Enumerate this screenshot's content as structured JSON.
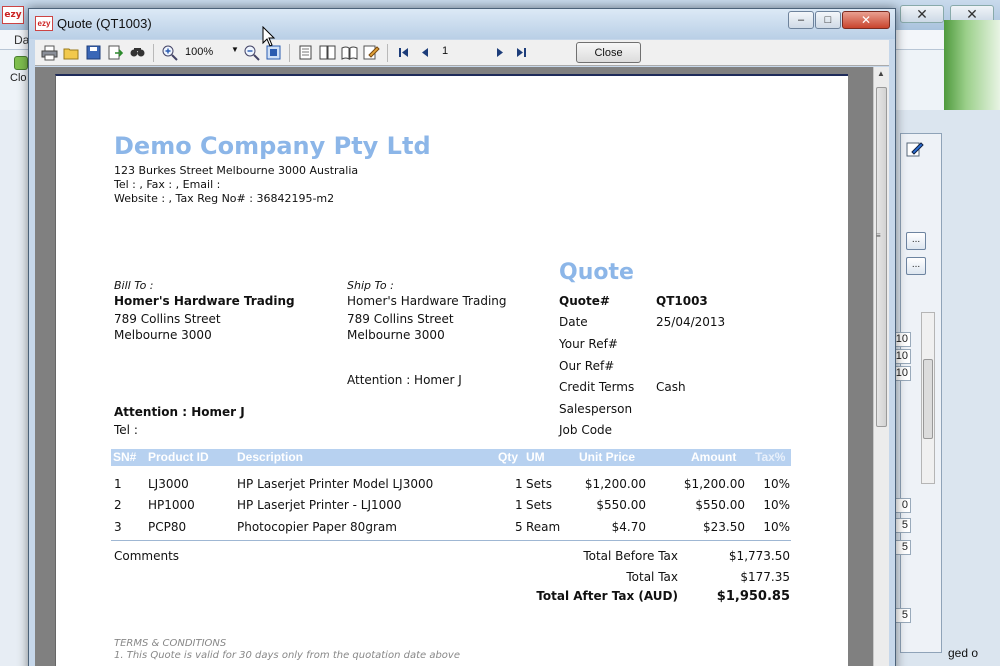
{
  "background_app": {
    "logo": "ezy",
    "menu_label": "Da",
    "toolbar_button": "Clo",
    "close_glyph": "✕",
    "cells": [
      "10",
      "10",
      "10",
      "0",
      "5",
      "5",
      "5"
    ],
    "ellipsis": "...",
    "bottom_text": "ged o"
  },
  "dialog": {
    "title": "Quote (QT1003)",
    "logo": "ezy",
    "minimize": "–",
    "maximize": "□",
    "close": "✕"
  },
  "toolbar": {
    "zoom": "100%",
    "page": "1",
    "close_label": "Close",
    "icons": [
      "print-icon",
      "open-icon",
      "save-icon",
      "export-icon",
      "find-icon",
      "zoom-in-icon",
      "zoom-out-icon",
      "fit-page-icon",
      "single-page-icon",
      "multi-page-icon",
      "book-icon",
      "edit-icon",
      "first-page-icon",
      "prev-page-icon",
      "next-page-icon",
      "last-page-icon"
    ]
  },
  "company": {
    "name": "Demo Company Pty Ltd",
    "address": "123 Burkes Street  Melbourne 3000  Australia",
    "contact": "Tel : , Fax : , Email :",
    "website": "Website : , Tax Reg No# : 36842195-m2"
  },
  "bill_to": {
    "label": "Bill To :",
    "name": "Homer's Hardware Trading",
    "street": "789 Collins Street",
    "city": "Melbourne 3000",
    "attention": "Attention : Homer J",
    "tel": "Tel :"
  },
  "ship_to": {
    "label": "Ship To :",
    "name": "Homer's Hardware Trading",
    "street": "789 Collins Street",
    "city": "Melbourne 3000",
    "attention": "Attention : Homer J"
  },
  "quote": {
    "title": "Quote",
    "fields": [
      {
        "label": "Quote#",
        "value": "QT1003"
      },
      {
        "label": "Date",
        "value": "25/04/2013"
      },
      {
        "label": "Your Ref#",
        "value": ""
      },
      {
        "label": "Our Ref#",
        "value": ""
      },
      {
        "label": "Credit Terms",
        "value": "Cash"
      },
      {
        "label": "Salesperson",
        "value": ""
      },
      {
        "label": "Job Code",
        "value": ""
      }
    ]
  },
  "items": {
    "headers": {
      "sn": "SN#",
      "product": "Product ID",
      "description": "Description",
      "qty": "Qty",
      "um": "UM",
      "unit_price": "Unit Price",
      "amount": "Amount",
      "tax": "Tax%"
    },
    "rows": [
      {
        "sn": "1",
        "product": "LJ3000",
        "description": "HP Laserjet Printer Model LJ3000",
        "qty": "1",
        "um": "Sets",
        "unit_price": "$1,200.00",
        "amount": "$1,200.00",
        "tax": "10%"
      },
      {
        "sn": "2",
        "product": "HP1000",
        "description": "HP Laserjet Printer - LJ1000",
        "qty": "1",
        "um": "Sets",
        "unit_price": "$550.00",
        "amount": "$550.00",
        "tax": "10%"
      },
      {
        "sn": "3",
        "product": "PCP80",
        "description": "Photocopier Paper 80gram",
        "qty": "5",
        "um": "Ream",
        "unit_price": "$4.70",
        "amount": "$23.50",
        "tax": "10%"
      }
    ]
  },
  "comments_label": "Comments",
  "totals": {
    "before_tax_label": "Total Before Tax",
    "before_tax": "$1,773.50",
    "tax_label": "Total Tax",
    "tax": "$177.35",
    "after_tax_label": "Total After Tax (AUD)",
    "after_tax": "$1,950.85"
  },
  "terms": {
    "title": "TERMS & CONDITIONS",
    "line1": "1. This Quote is valid for 30 days only from the quotation date above"
  }
}
